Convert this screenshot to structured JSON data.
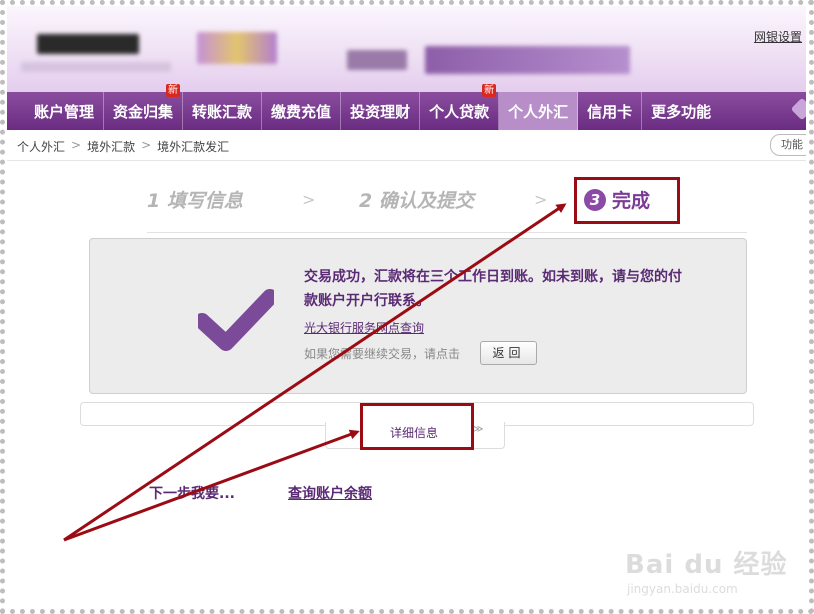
{
  "header": {
    "settings_link": "网银设置"
  },
  "nav": {
    "items": [
      {
        "label": "账户管理",
        "badge": null
      },
      {
        "label": "资金归集",
        "badge": "新"
      },
      {
        "label": "转账汇款",
        "badge": null
      },
      {
        "label": "缴费充值",
        "badge": null
      },
      {
        "label": "投资理财",
        "badge": null
      },
      {
        "label": "个人贷款",
        "badge": "新"
      },
      {
        "label": "个人外汇",
        "badge": null,
        "active": true
      },
      {
        "label": "信用卡",
        "badge": null
      },
      {
        "label": "更多功能",
        "badge": null
      }
    ]
  },
  "breadcrumb": [
    "个人外汇",
    "境外汇款",
    "境外汇款发汇"
  ],
  "breadcrumb_sep": ">",
  "function_button": "功能",
  "steps": {
    "step1": "1 填写信息",
    "step2": "2 确认及提交",
    "step3_number": "3",
    "step3_label": "完成",
    "chevron": ">"
  },
  "result": {
    "message": "交易成功，汇款将在三个工作日到账。如未到账，请与您的付款账户开户行联系。",
    "service_link": "光大银行服务网点查询",
    "continue_text": "如果您需要继续交易，请点击",
    "return_button": "返回"
  },
  "details": {
    "label": "详细信息",
    "chevron": "≫"
  },
  "next_steps": {
    "label": "下一步我要...",
    "balance_link": "查询账户余额"
  },
  "watermark": {
    "logo": "Bai du 经验",
    "url": "jingyan.baidu.com"
  },
  "colors": {
    "brand_purple": "#6a2c82",
    "annotation_red": "#9b0b14"
  }
}
